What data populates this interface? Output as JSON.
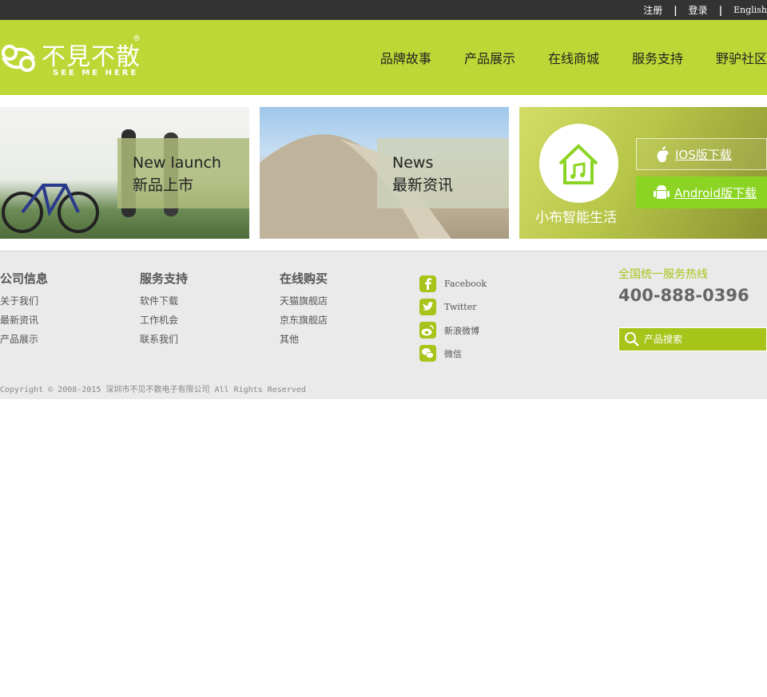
{
  "topbar": {
    "register": "注册",
    "sep1": "|",
    "login": "登录",
    "sep2": "|",
    "lang": "English"
  },
  "logo": {
    "cn": "不見不散",
    "en": "SEE ME HERE",
    "reg": "®"
  },
  "nav": [
    "品牌故事",
    "产品展示",
    "在线商城",
    "服务支持",
    "野驴社区"
  ],
  "banners": {
    "newlaunch": {
      "en": "New launch",
      "cn": "新品上市"
    },
    "news": {
      "en": "News",
      "cn": "最新资讯"
    },
    "app": {
      "slogan": "小布智能生活",
      "ios": "IOS版下载",
      "android": "Android版下载"
    }
  },
  "footer": {
    "company": {
      "title": "公司信息",
      "links": [
        "关于我们",
        "最新资讯",
        "产品展示"
      ]
    },
    "service": {
      "title": "服务支持",
      "links": [
        "软件下载",
        "工作机会",
        "联系我们"
      ]
    },
    "shop": {
      "title": "在线购买",
      "links": [
        "天猫旗舰店",
        "京东旗舰店",
        "其他"
      ]
    },
    "social": [
      "Facebook",
      "Twitter",
      "新浪微博",
      "微信"
    ],
    "hotline_label": "全国统一服务热线",
    "hotline": "400-888-0396",
    "search_placeholder": "产品搜索",
    "copyright": "Copyright © 2008-2015 深圳市不见不散电子有限公司 All Rights Reserved"
  },
  "colors": {
    "brand_green": "#bdd836",
    "accent_green": "#a6c419",
    "topbar": "#333333",
    "footer_bg": "#eaeaea"
  }
}
